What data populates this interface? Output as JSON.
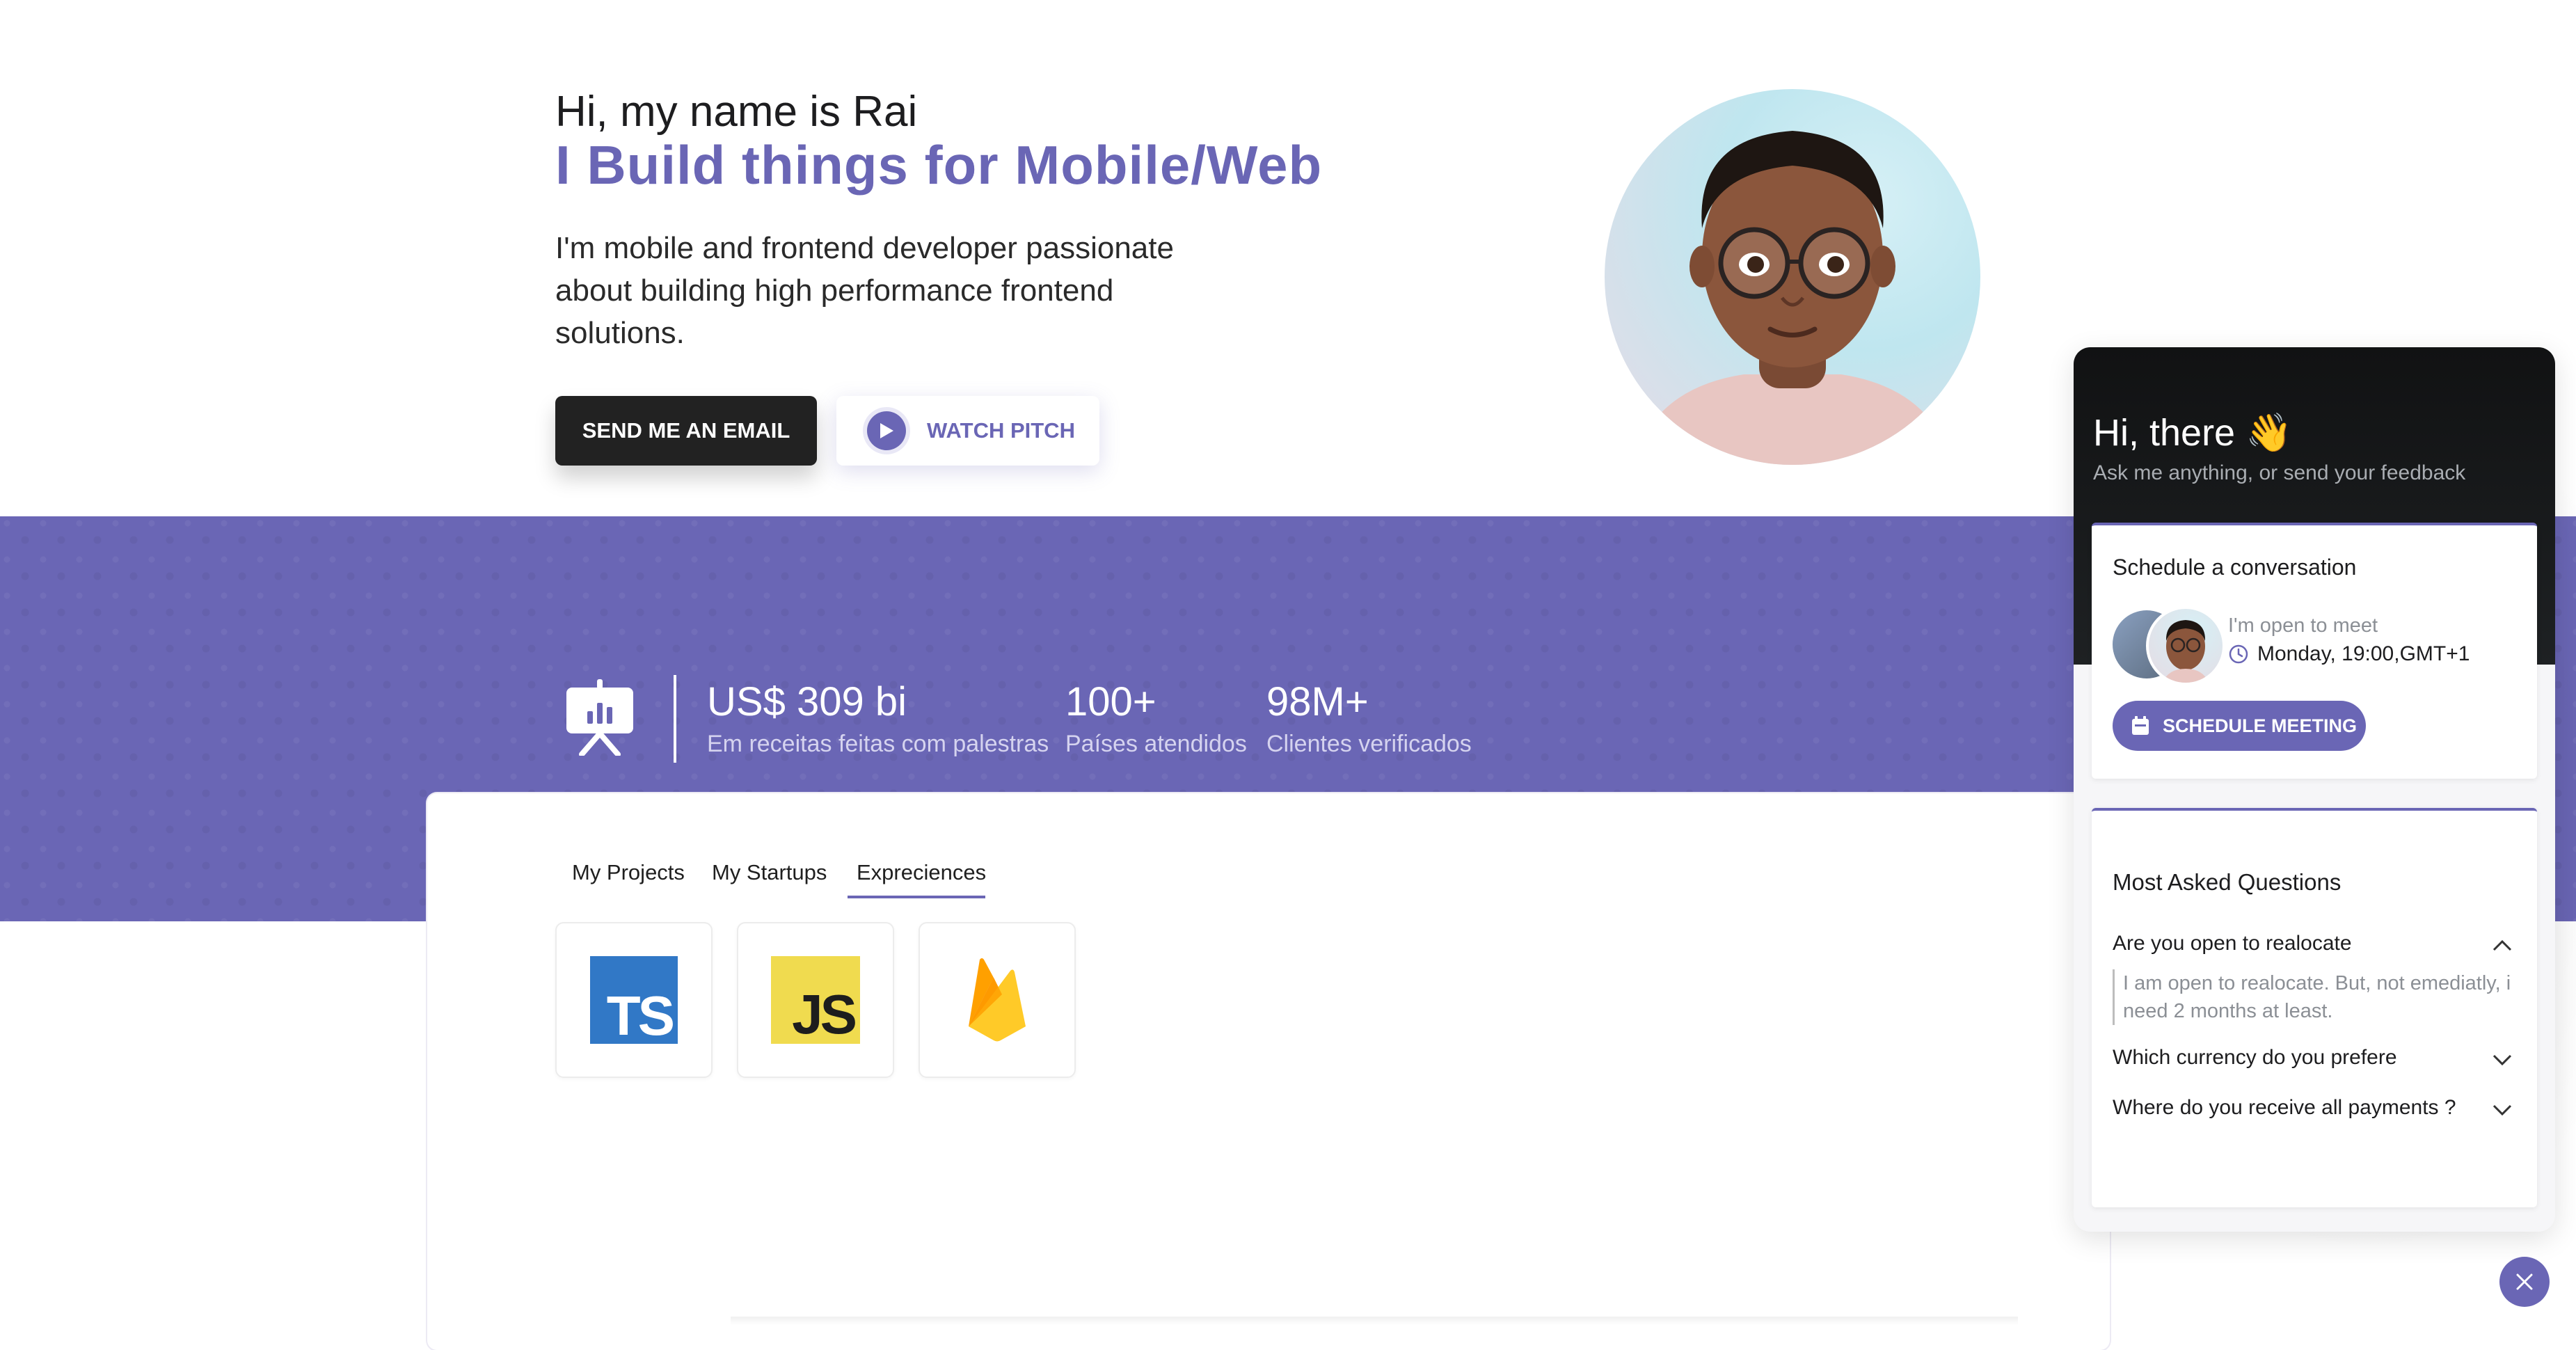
{
  "hero": {
    "greeting": "Hi, my name is Rai",
    "headline": "I Build things for Mobile/Web",
    "description": "I'm mobile and frontend developer passionate about building high performance frontend solutions.",
    "email_button": "SEND ME AN EMAIL",
    "pitch_button": "WATCH PITCH"
  },
  "stats": [
    {
      "value": "US$ 309 bi",
      "label": "Em receitas feitas com palestras"
    },
    {
      "value": "100+",
      "label": "Países atendidos"
    },
    {
      "value": "98M+",
      "label": "Clientes verificados"
    }
  ],
  "tabs": [
    {
      "label": "My Projects"
    },
    {
      "label": "My Startups"
    },
    {
      "label": "Exprecie nces",
      "active": true
    }
  ],
  "technologies": [
    {
      "name": "TypeScript",
      "badge": "TS"
    },
    {
      "name": "JavaScript",
      "badge": "JS"
    },
    {
      "name": "Firebase"
    }
  ],
  "chat": {
    "greeting": "Hi, there 👋",
    "subtitle": "Ask me anything, or send your feedback",
    "schedule": {
      "title": "Schedule a conversation",
      "open_text": "I'm open to meet",
      "time": "Monday, 19:00,GMT+1",
      "button": "SCHEDULE MEETING"
    },
    "faq": {
      "title": "Most Asked Questions",
      "items": [
        {
          "question": "Are you open to realocate",
          "answer": "I am open to realocate. But, not emediatly, i need 2 months at least.",
          "expanded": true
        },
        {
          "question": "Which currency do you prefere",
          "expanded": false
        },
        {
          "question": "Where do you receive all payments ?",
          "expanded": false
        }
      ]
    }
  },
  "colors": {
    "accent": "#6a66b5",
    "dark_button": "#222222",
    "chat_header": "#16181a"
  }
}
